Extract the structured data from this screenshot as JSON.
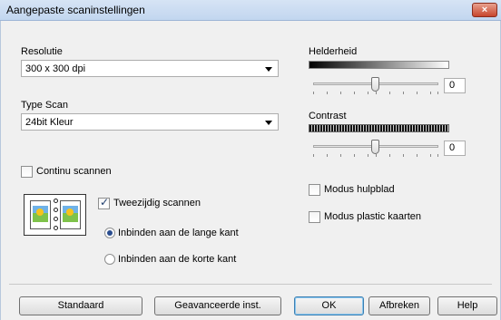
{
  "window": {
    "title": "Aangepaste scaninstellingen",
    "close_label": "×"
  },
  "resolution": {
    "label": "Resolutie",
    "value": "300 x 300 dpi"
  },
  "scan_type": {
    "label": "Type Scan",
    "value": "24bit Kleur"
  },
  "brightness": {
    "label": "Helderheid",
    "value": "0"
  },
  "contrast": {
    "label": "Contrast",
    "value": "0"
  },
  "continuous_scan": {
    "label": "Continu scannen",
    "checked": false
  },
  "duplex": {
    "label": "Tweezijdig scannen",
    "checked": true,
    "long_edge": "Inbinden aan de lange kant",
    "short_edge": "Inbinden aan de korte kant",
    "selected": "long_edge"
  },
  "carrier_sheet": {
    "label": "Modus hulpblad",
    "checked": false
  },
  "plastic_card": {
    "label": "Modus plastic kaarten",
    "checked": false
  },
  "buttons": {
    "default": "Standaard",
    "advanced": "Geavanceerde inst.",
    "ok": "OK",
    "cancel": "Afbreken",
    "help": "Help"
  }
}
